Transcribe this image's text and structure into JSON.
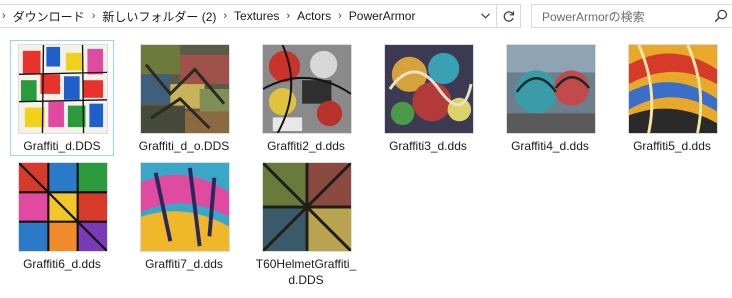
{
  "breadcrumb": {
    "items": [
      "ダウンロード",
      "新しいフォルダー (2)",
      "Textures",
      "Actors",
      "PowerArmor"
    ],
    "separator_glyph": "›"
  },
  "search": {
    "placeholder": "PowerArmorの検索"
  },
  "icons": {
    "address_dropdown": "chevron-down-icon",
    "refresh": "refresh-icon",
    "search": "search-icon"
  },
  "colors": {
    "selection_border": "#99d1ff",
    "border": "#d9d9d9",
    "placeholder": "#6d6d6d"
  },
  "files": [
    {
      "name": "Graffiti_d.DDS",
      "selected": true
    },
    {
      "name": "Graffiti_d_o.DDS"
    },
    {
      "name": "Graffiti2_d.dds"
    },
    {
      "name": "Graffiti3_d.dds"
    },
    {
      "name": "Graffiti4_d.dds"
    },
    {
      "name": "Graffiti5_d.dds"
    },
    {
      "name": "Graffiti6_d.dds"
    },
    {
      "name": "Graffiti7_d.dds"
    },
    {
      "name": "T60HelmetGraffiti_d.DDS"
    }
  ]
}
